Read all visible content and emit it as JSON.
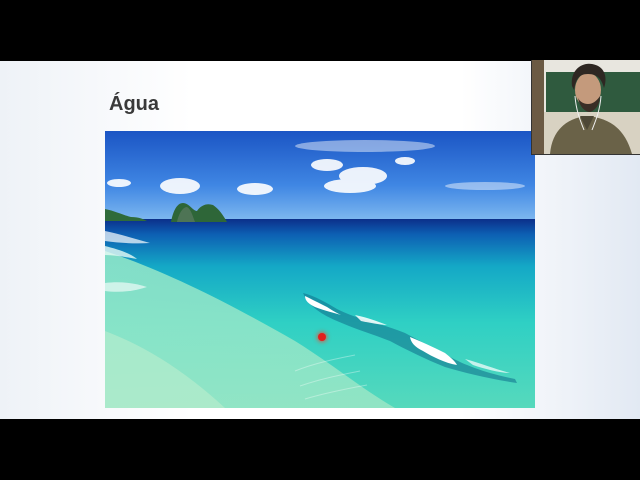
{
  "slide": {
    "title": "Água",
    "image_description_icon": "beach-photo",
    "pointer_icon": "laser-pointer"
  },
  "webcam": {
    "icon": "presenter-webcam"
  }
}
